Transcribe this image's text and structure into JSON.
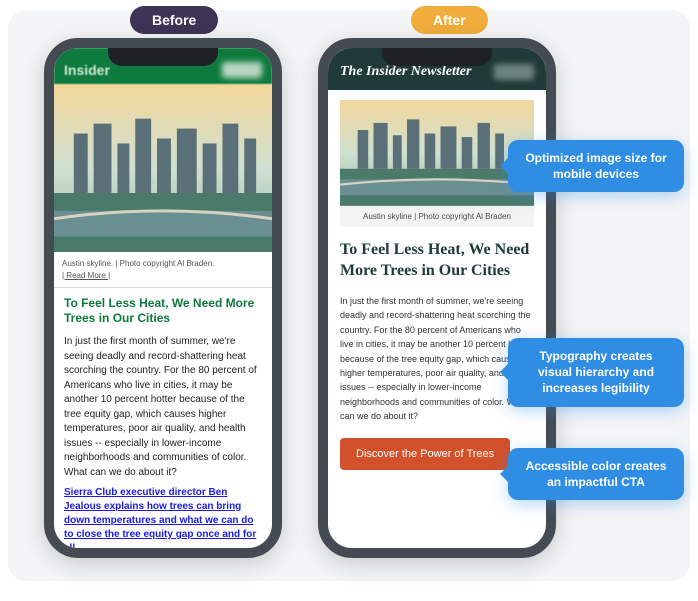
{
  "labels": {
    "before": "Before",
    "after": "After"
  },
  "before": {
    "header_title": "Insider",
    "caption": "Austin skyline. | Photo copyright Al Braden.",
    "caption_link": "| Read More |",
    "heading": "To Feel Less Heat, We Need More Trees in Our Cities",
    "body": "In just the first month of summer, we're seeing deadly and record-shattering heat scorching the country. For the 80 percent of Americans who live in cities, it may be another 10 percent hotter because of the tree equity gap, which causes higher temperatures, poor air quality, and health issues -- especially in lower-income neighborhoods and communities of color. What can we do about it?",
    "link_text": "Sierra Club executive director Ben Jealous explains how trees can bring down temperatures and what we can do to close the tree equity gap once and for all."
  },
  "after": {
    "header_title": "The Insider Newsletter",
    "caption": "Austin skyline | Photo copyright Al Braden",
    "heading": "To Feel Less Heat, We Need More Trees in Our Cities",
    "body": "In just the first month of summer, we're seeing deadly and record-shattering heat scorching the country. For the 80 percent of Americans who live in cities, it may be another 10 percent hotter because of the tree equity gap, which causes higher temperatures, poor air quality, and health issues -- especially in lower-income neighborhoods and communities of color. What can we do about it?",
    "cta_label": "Discover the Power of Trees"
  },
  "callouts": {
    "c1": "Optimized image size for mobile devices",
    "c2": "Typography creates visual hierarchy and increases legibility",
    "c3": "Accessible color creates an impactful CTA"
  }
}
